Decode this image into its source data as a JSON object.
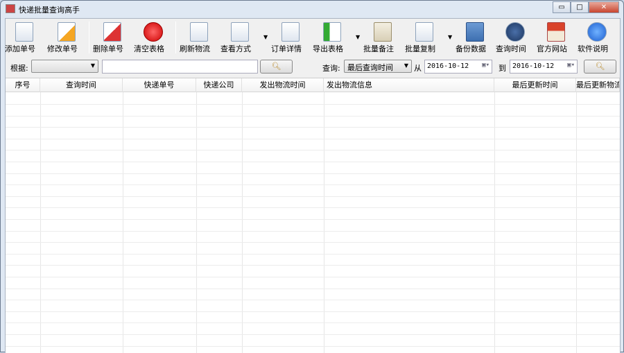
{
  "window": {
    "title": "快递批量查询高手",
    "minimize": "▭",
    "maximize": "□",
    "close": "✕"
  },
  "toolbar": [
    {
      "id": "add",
      "label": "添加单号",
      "icon": "add-document-icon"
    },
    {
      "id": "edit",
      "label": "修改单号",
      "icon": "pencil-document-icon"
    },
    {
      "id": "delete",
      "label": "删除单号",
      "icon": "delete-document-icon"
    },
    {
      "id": "clear",
      "label": "清空表格",
      "icon": "red-x-circle-icon"
    },
    {
      "id": "refresh",
      "label": "刷新物流",
      "icon": "document-lines-icon"
    },
    {
      "id": "view",
      "label": "查看方式",
      "icon": "checklist-icon",
      "dropdown": true
    },
    {
      "id": "detail",
      "label": "订单详情",
      "icon": "form-icon"
    },
    {
      "id": "export",
      "label": "导出表格",
      "icon": "export-arrow-icon",
      "dropdown": true
    },
    {
      "id": "note",
      "label": "批量备注",
      "icon": "scroll-icon"
    },
    {
      "id": "copy",
      "label": "批量复制",
      "icon": "copy-documents-icon",
      "dropdown": true
    },
    {
      "id": "backup",
      "label": "备份数据",
      "icon": "floppy-disk-icon"
    },
    {
      "id": "time",
      "label": "查询时间",
      "icon": "clock-icon"
    },
    {
      "id": "site",
      "label": "官方网站",
      "icon": "house-icon"
    },
    {
      "id": "help",
      "label": "软件说明",
      "icon": "help-icon"
    }
  ],
  "filter": {
    "basis_label": "根据:",
    "basis_value": "",
    "keyword": "",
    "query_label": "查询:",
    "query_value": "最后查询时间",
    "from_label": "从",
    "from_date": "2016-10-12",
    "to_label": "到",
    "to_date": "2016-10-12"
  },
  "table": {
    "columns": [
      "序号",
      "查询时间",
      "快递单号",
      "快递公司",
      "发出物流时间",
      "发出物流信息",
      "最后更新时间",
      "最后更新物流"
    ],
    "rows": []
  }
}
